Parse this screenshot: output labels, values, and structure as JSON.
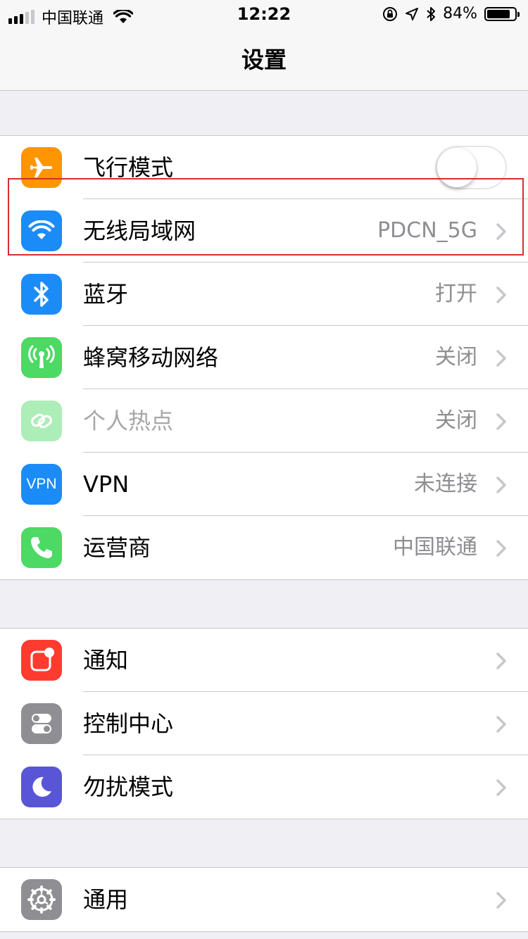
{
  "status_bar": {
    "carrier": "中国联通",
    "time": "12:22",
    "battery_percent": "84%",
    "battery_level": 0.84,
    "icons": [
      "signal-icon",
      "wifi-icon",
      "orientation-lock-icon",
      "location-icon",
      "bluetooth-icon",
      "battery-icon"
    ]
  },
  "nav": {
    "title": "设置"
  },
  "groups": [
    {
      "rows": [
        {
          "label": "飞行模式",
          "value": "",
          "control": "toggle",
          "toggle_on": false,
          "icon": "airplane-icon",
          "icon_color": "#ff9500"
        },
        {
          "label": "无线局域网",
          "value": "PDCN_5G",
          "icon": "wifi-icon",
          "icon_color": "#1b8cf7",
          "highlighted": true
        },
        {
          "label": "蓝牙",
          "value": "打开",
          "icon": "bluetooth-icon",
          "icon_color": "#1b8cf7"
        },
        {
          "label": "蜂窝移动网络",
          "value": "关闭",
          "icon": "cellular-icon",
          "icon_color": "#4cd964"
        },
        {
          "label": "个人热点",
          "value": "关闭",
          "icon": "hotspot-icon",
          "icon_color": "#4cd964",
          "disabled": true
        },
        {
          "label": "VPN",
          "value": "未连接",
          "icon": "vpn-icon",
          "icon_color": "#1b8cf7",
          "icon_text": "VPN"
        },
        {
          "label": "运营商",
          "value": "中国联通",
          "icon": "phone-icon",
          "icon_color": "#4cd964"
        }
      ]
    },
    {
      "rows": [
        {
          "label": "通知",
          "value": "",
          "icon": "notifications-icon",
          "icon_color": "#ff3b30"
        },
        {
          "label": "控制中心",
          "value": "",
          "icon": "control-center-icon",
          "icon_color": "#8e8e93"
        },
        {
          "label": "勿扰模式",
          "value": "",
          "icon": "moon-icon",
          "icon_color": "#5856d6"
        }
      ]
    },
    {
      "rows": [
        {
          "label": "通用",
          "value": "",
          "icon": "gear-icon",
          "icon_color": "#8e8e93"
        }
      ]
    }
  ],
  "annotation": {
    "highlight_color": "#d32f2f"
  }
}
